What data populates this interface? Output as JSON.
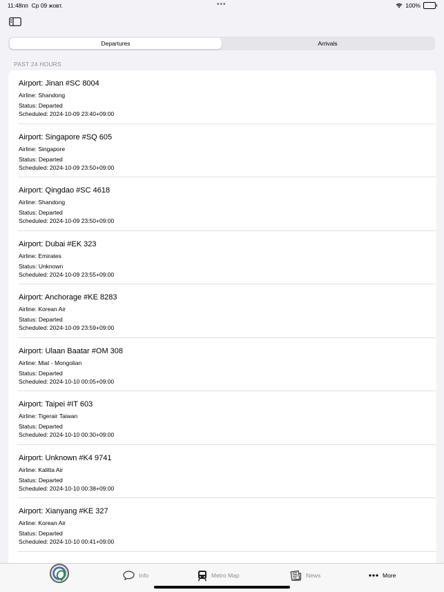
{
  "status_bar": {
    "time": "11:48пп",
    "date": "Ср 09 жовт.",
    "battery": "100%",
    "wifi_icon": "wifi-icon",
    "battery_icon": "battery-full-icon"
  },
  "toolbar": {
    "sidebar_icon": "sidebar-toggle-icon"
  },
  "segments": {
    "departures": "Departures",
    "arrivals": "Arrivals",
    "selected": "Departures"
  },
  "section_header": "PAST 24 HOURS",
  "flights": [
    {
      "title": "Airport: Jinan #SC 8004",
      "airline": "Airline: Shandong",
      "status": "Status: Departed",
      "scheduled": "Scheduled: 2024-10-09 23:40+09:00"
    },
    {
      "title": "Airport: Singapore #SQ 605",
      "airline": "Airline: Singapore",
      "status": "Status: Departed",
      "scheduled": "Scheduled: 2024-10-09 23:50+09:00"
    },
    {
      "title": "Airport: Qingdao #SC 4618",
      "airline": "Airline: Shandong",
      "status": "Status: Departed",
      "scheduled": "Scheduled: 2024-10-09 23:50+09:00"
    },
    {
      "title": "Airport: Dubai #EK 323",
      "airline": "Airline: Emirates",
      "status": "Status: Unknown",
      "scheduled": "Scheduled: 2024-10-09 23:55+09:00"
    },
    {
      "title": "Airport: Anchorage #KE 8283",
      "airline": "Airline: Korean Air",
      "status": "Status: Departed",
      "scheduled": "Scheduled: 2024-10-09 23:59+09:00"
    },
    {
      "title": "Airport: Ulaan Baatar #OM 308",
      "airline": "Airline: Miat - Mongolian",
      "status": "Status: Departed",
      "scheduled": "Scheduled: 2024-10-10 00:05+09:00"
    },
    {
      "title": "Airport: Taipei #IT 603",
      "airline": "Airline: Tigerair Taiwan",
      "status": "Status: Departed",
      "scheduled": "Scheduled: 2024-10-10 00:30+09:00"
    },
    {
      "title": "Airport: Unknown #K4 9741",
      "airline": "Airline: Kalitta Air",
      "status": "Status: Departed",
      "scheduled": "Scheduled: 2024-10-10 00:38+09:00"
    },
    {
      "title": "Airport: Xianyang #KE 327",
      "airline": "Airline: Korean Air",
      "status": "Status: Departed",
      "scheduled": "Scheduled: 2024-10-10 00:41+09:00"
    }
  ],
  "tab_bar": {
    "home_icon": "app-logo-icon",
    "info": "Info",
    "metro_map": "Metro Map",
    "news": "News",
    "more": "More"
  }
}
